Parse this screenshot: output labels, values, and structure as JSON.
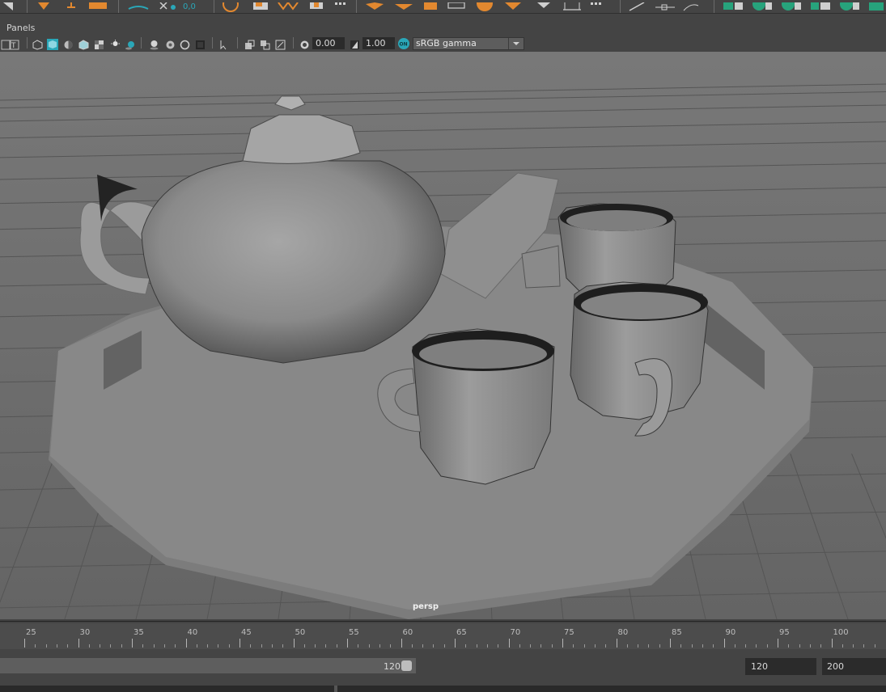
{
  "panel_menu": {
    "label": "Panels"
  },
  "panel_toolbar": {
    "exposure_value": "0.00",
    "gamma_value": "1.00",
    "color_space": "sRGB gamma",
    "color_mgmt_badge": "ON"
  },
  "viewport": {
    "camera_label": "persp"
  },
  "time_slider": {
    "ticks": [
      {
        "label": "25"
      },
      {
        "label": "30"
      },
      {
        "label": "35"
      },
      {
        "label": "40"
      },
      {
        "label": "45"
      },
      {
        "label": "50"
      },
      {
        "label": "55"
      },
      {
        "label": "60"
      },
      {
        "label": "65"
      },
      {
        "label": "70"
      },
      {
        "label": "75"
      },
      {
        "label": "80"
      },
      {
        "label": "85"
      },
      {
        "label": "90"
      },
      {
        "label": "95"
      },
      {
        "label": "100"
      }
    ]
  },
  "range_slider": {
    "playback_end": "120",
    "range_end_field": "120",
    "anim_end_field": "200"
  },
  "colors": {
    "ui_background": "#444444",
    "viewport_background": "#6e6e6e",
    "accent_orange": "#e2882f",
    "accent_teal": "#2aa7b8",
    "accent_green": "#27a37c"
  }
}
